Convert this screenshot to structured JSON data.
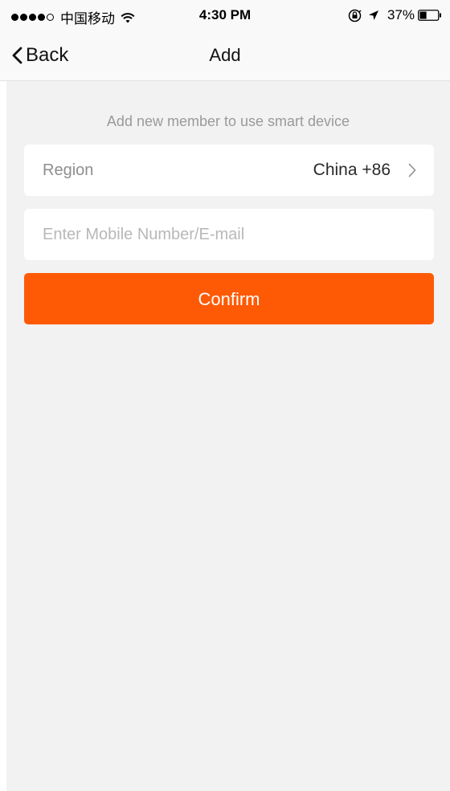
{
  "status_bar": {
    "carrier": "中国移动",
    "time": "4:30 PM",
    "battery_percent": "37%",
    "battery_level": 0.37,
    "signal_bars_filled": 4,
    "signal_bars_total": 5,
    "icons": [
      "signal-dots",
      "wifi-icon",
      "orientation-lock-icon",
      "location-arrow-icon",
      "battery-icon"
    ]
  },
  "nav": {
    "back_label": "Back",
    "title": "Add"
  },
  "main": {
    "subtitle": "Add new member to use smart device",
    "region": {
      "label": "Region",
      "value": "China +86"
    },
    "input": {
      "placeholder": "Enter Mobile Number/E-mail",
      "value": ""
    },
    "confirm_label": "Confirm"
  },
  "colors": {
    "accent": "#fe5a06",
    "background": "#f2f2f2",
    "card": "#ffffff",
    "nav_background": "#f9f9f9"
  }
}
